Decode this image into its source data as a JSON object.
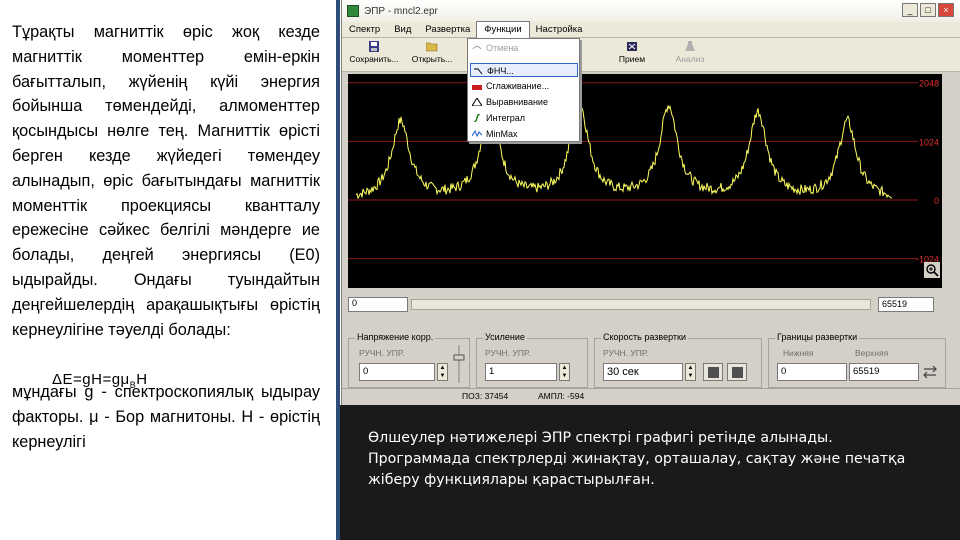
{
  "left_text": {
    "para1": "Тұрақты магниттік өріс жоқ кезде магниттік моменттер емін-еркін бағытталып, жүйенің күйі энергия бойынша төмендейді, алмоменттер қосындысы нөлге тең. Магниттік өрісті берген кезде жүйедегі төмендеу алынадып, өріс бағытындағы магниттік моменттік проекциясы квантталу ережесіне сәйкес белгілі мәндерге ие болады, деңгей энергиясы (E0) ыдырайды. Ондағы туындайтын деңгейшелердің арақашықтығы өрістің кернеулігіне тәуелді болады:",
    "formula": "ΔE=gH=gμ",
    "formula_sub": "B",
    "formula_tail": "H",
    "para2": "мұндағы g - спектроскопиялық ыдырау факторы. μ - Бор магнитоны. H - өрістің кернеулігі"
  },
  "caption": "Өлшеулер нәтижелері ЭПР спектрі графигі ретінде алынады. Программада спектрлерді жинақтау, орташалау, сақтау және печатқа жіберу функциялары қарастырылған.",
  "window": {
    "title": "ЭПР - mncl2.epr",
    "min_label": "_",
    "max_label": "□",
    "close_label": "×",
    "menu": [
      "Спектр",
      "Вид",
      "Развертка",
      "Функции",
      "Настройка"
    ],
    "active_menu_index": 3,
    "toolbar": {
      "save": "Сохранить...",
      "open": "Открыть...",
      "receive": "Прием",
      "analyze": "Анализ"
    },
    "dropdown": [
      {
        "label": "Отмена",
        "disabled": true
      },
      {
        "label": "ФНЧ...",
        "disabled": false,
        "highlighted": true
      },
      {
        "label": "Сглаживание...",
        "disabled": false
      },
      {
        "label": "Выравнивание",
        "disabled": false
      },
      {
        "label": "Интеграл",
        "disabled": false
      },
      {
        "label": "MinMax",
        "disabled": false
      }
    ],
    "y_labels": [
      "2048",
      "1024",
      "0",
      "-1024"
    ],
    "position_value": "0",
    "points_value": "65519",
    "groups": {
      "voltage": {
        "title": "Напряжение корр.",
        "mode": "РУЧН. УПР.",
        "value": "0"
      },
      "gain": {
        "title": "Усиление",
        "mode": "РУЧН. УПР.",
        "value": "1"
      },
      "speed": {
        "title": "Скорость развертки",
        "mode": "РУЧН. УПР.",
        "value": "30 сек"
      },
      "bounds": {
        "title": "Границы развертки",
        "lower_label": "Нижняя",
        "upper_label": "Верхняя",
        "lower_value": "0",
        "upper_value": "65519"
      }
    },
    "status": {
      "left": "ПОЗ: 37454",
      "right": "АМПЛ: -594"
    }
  },
  "chart_data": {
    "type": "line",
    "title": "",
    "xlabel": "",
    "ylabel": "",
    "ylim": [
      -1536,
      2200
    ],
    "y_ticks": [
      2048,
      1024,
      0,
      -1024
    ],
    "series": [
      {
        "color": "#ffff60",
        "peaks_count": 6,
        "baseline": 0,
        "peak_values": [
          1350,
          1600,
          1650,
          1600,
          1500,
          1350
        ]
      }
    ],
    "grid": "horizontal"
  }
}
